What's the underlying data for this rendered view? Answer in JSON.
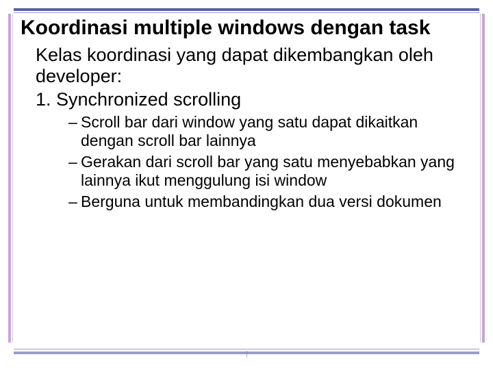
{
  "title": "Koordinasi multiple windows dengan task",
  "intro": "Kelas koordinasi yang dapat dikembangkan  oleh developer:",
  "list": {
    "num1": "1. Synchronized scrolling"
  },
  "bullets": {
    "b1": "Scroll bar dari window yang satu dapat dikaitkan dengan scroll bar lainnya",
    "b2": "Gerakan dari scroll bar yang satu menyebabkan yang lainnya ikut menggulung isi window",
    "b3": "Berguna untuk membandingkan dua versi dokumen"
  }
}
